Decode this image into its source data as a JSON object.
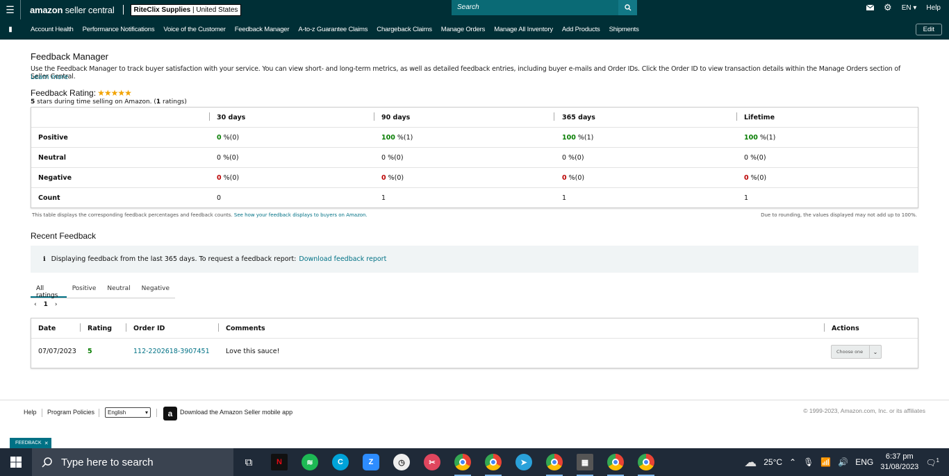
{
  "topbar": {
    "logo_bold": "amazon",
    "logo_rest": " seller central",
    "store_name": "RiteClix Supplies",
    "store_region": "United States",
    "search_placeholder": "Search",
    "lang": "EN",
    "help": "Help"
  },
  "nav": {
    "items": [
      "Account Health",
      "Performance Notifications",
      "Voice of the Customer",
      "Feedback Manager",
      "A-to-z Guarantee Claims",
      "Chargeback Claims",
      "Manage Orders",
      "Manage All Inventory",
      "Add Products",
      "Shipments"
    ],
    "edit": "Edit"
  },
  "page": {
    "title": "Feedback Manager",
    "description": "Use the Feedback Manager to track buyer satisfaction with your service. You can view short- and long-term metrics, as well as detailed feedback entries, including buyer e-mails and Order IDs. Click the Order ID to view transaction details within the Manage Orders section of Seller Central.",
    "learn_more": "Learn more",
    "rating_title": "Feedback Rating:",
    "stars": "★★★★★",
    "rating_value": "5",
    "rating_sub_mid": " stars during time selling on Amazon. (",
    "rating_count": "1",
    "rating_sub_end": " ratings)"
  },
  "feedback_table": {
    "headers": [
      "30 days",
      "90 days",
      "365 days",
      "Lifetime"
    ],
    "rows": [
      {
        "label": "Positive",
        "cells": [
          {
            "v": "0",
            "c": "(0)"
          },
          {
            "v": "100",
            "c": "(1)"
          },
          {
            "v": "100",
            "c": "(1)"
          },
          {
            "v": "100",
            "c": "(1)"
          }
        ]
      },
      {
        "label": "Neutral",
        "cells": [
          {
            "v": "0",
            "c": "(0)"
          },
          {
            "v": "0",
            "c": "(0)"
          },
          {
            "v": "0",
            "c": "(0)"
          },
          {
            "v": "0",
            "c": "(0)"
          }
        ]
      },
      {
        "label": "Negative",
        "cells": [
          {
            "v": "0",
            "c": "(0)"
          },
          {
            "v": "0",
            "c": "(0)"
          },
          {
            "v": "0",
            "c": "(0)"
          },
          {
            "v": "0",
            "c": "(0)"
          }
        ]
      }
    ],
    "count_label": "Count",
    "counts": [
      "0",
      "1",
      "1",
      "1"
    ],
    "pct_suffix": " %",
    "note_left": "This table displays the corresponding feedback percentages and feedback counts.",
    "note_link": "See how your feedback displays to buyers on Amazon.",
    "note_right": "Due to rounding, the values displayed may not add up to 100%."
  },
  "recent": {
    "title": "Recent Feedback",
    "info_text": "Displaying feedback from the last 365 days. To request a feedback report:",
    "info_link": "Download feedback report",
    "tabs": [
      "All ratings",
      "Positive",
      "Neutral",
      "Negative"
    ],
    "page": "1",
    "headers": {
      "date": "Date",
      "rating": "Rating",
      "order": "Order ID",
      "comments": "Comments",
      "actions": "Actions"
    },
    "row": {
      "date": "07/07/2023",
      "rating": "5",
      "order": "112-2202618-3907451",
      "comment": "Love this sauce!",
      "action": "Choose one"
    }
  },
  "footer": {
    "help": "Help",
    "policies": "Program Policies",
    "language": "English",
    "app": "Download the Amazon Seller mobile app",
    "copyright": "© 1999-2023, Amazon.com, Inc. or its affiliates",
    "feedback_tab": "FEEDBACK"
  },
  "taskbar": {
    "search": "Type here to search",
    "temp": "25°C",
    "lang": "ENG",
    "time": "6:37 pm",
    "date": "31/08/2023",
    "notif_count": "1"
  }
}
